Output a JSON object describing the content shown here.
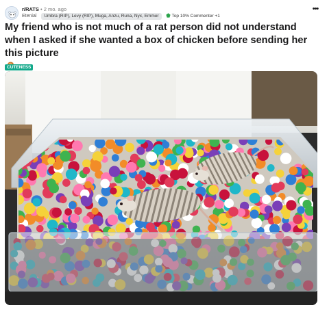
{
  "post": {
    "subreddit": "r/RATS",
    "separator": "•",
    "age": "2 mo. ago",
    "username": "Etenial",
    "flair": "Umbra (RIP), Levy (RIP), Muga, Anzu, Runa, Nyx, Emmer",
    "award_label": "Top 10% Commenter +1",
    "title": "My friend who is not much of a rat person did not understand when I asked if she wanted a box of chicken before sending her this picture",
    "tag": "CUTENESS",
    "more_menu": "•••"
  },
  "icons": {
    "avatar": "snoo-avatar",
    "award": "top-commenter-icon",
    "title_emoji": "poultry-leg-emoji",
    "more": "more-options-icon"
  },
  "colors": {
    "tag_bg": "#12a88a",
    "award": "#2aa34a",
    "photo_bg": "#2b2b2b"
  }
}
